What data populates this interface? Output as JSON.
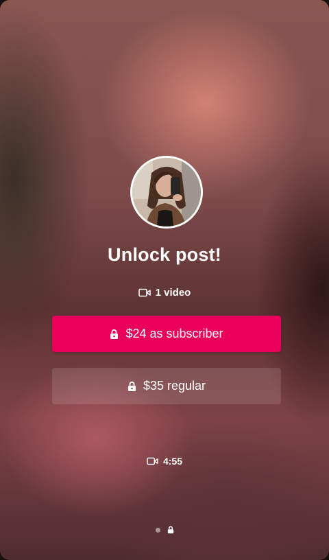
{
  "post": {
    "title": "Unlock post!",
    "media_count_label": "1 video",
    "duration": "4:55"
  },
  "actions": {
    "subscriber_label": "$24 as subscriber",
    "regular_label": "$35 regular"
  },
  "icons": {
    "video": "video-camera-icon",
    "lock": "lock-icon"
  },
  "pager": {
    "items": [
      "dot",
      "lock"
    ],
    "current": 1
  },
  "colors": {
    "primary_button": "#e8005a",
    "text": "#ffffff"
  }
}
